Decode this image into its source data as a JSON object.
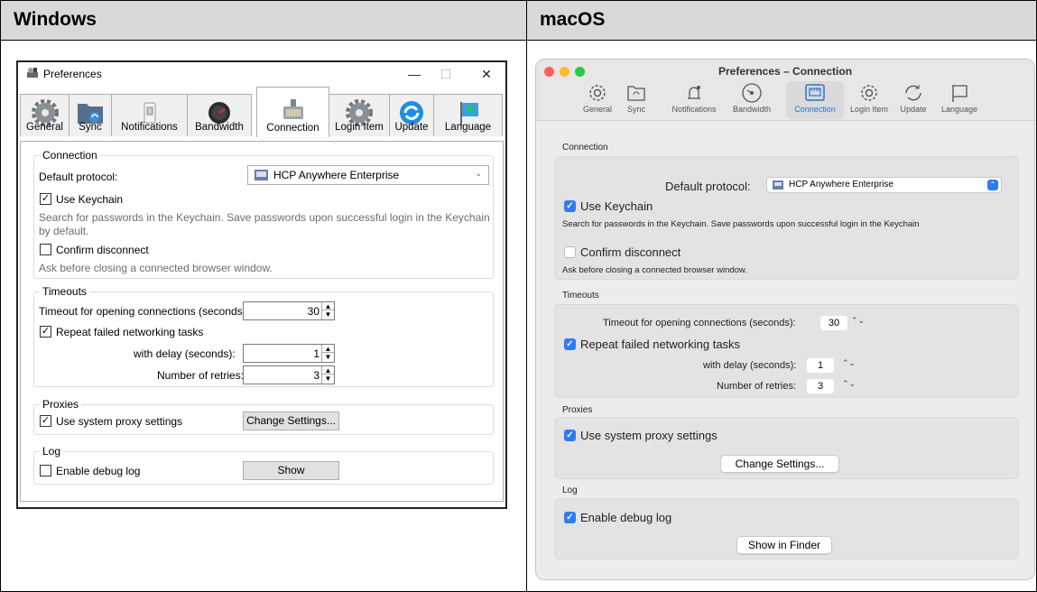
{
  "columns": {
    "windows_header": "Windows",
    "macos_header": "macOS"
  },
  "windows": {
    "title": "Preferences",
    "controls": {
      "minimize": "—",
      "maximize": "☐",
      "close": "✕"
    },
    "tabs": [
      {
        "label": "General",
        "icon": "gear-icon"
      },
      {
        "label": "Sync",
        "icon": "sync-folder-icon"
      },
      {
        "label": "Notifications",
        "icon": "switch-icon"
      },
      {
        "label": "Bandwidth",
        "icon": "gauge-icon"
      },
      {
        "label": "Connection",
        "icon": "network-connector-icon",
        "active": true
      },
      {
        "label": "Login Item",
        "icon": "gear-icon"
      },
      {
        "label": "Update",
        "icon": "update-icon"
      },
      {
        "label": "Language",
        "icon": "flag-icon"
      }
    ],
    "connection": {
      "group_title": "Connection",
      "default_protocol_label": "Default protocol:",
      "default_protocol_value": "HCP Anywhere Enterprise",
      "use_keychain_label": "Use Keychain",
      "use_keychain_checked": true,
      "keychain_help": "Search for passwords in the Keychain. Save passwords upon successful login in the Keychain by default.",
      "confirm_disconnect_label": "Confirm disconnect",
      "confirm_disconnect_checked": false,
      "confirm_help": "Ask before closing a connected browser window."
    },
    "timeouts": {
      "group_title": "Timeouts",
      "timeout_label": "Timeout for opening connections (seconds):",
      "timeout_value": "30",
      "repeat_label": "Repeat failed networking tasks",
      "repeat_checked": true,
      "delay_label": "with delay (seconds):",
      "delay_value": "1",
      "retries_label": "Number of retries:",
      "retries_value": "3"
    },
    "proxies": {
      "group_title": "Proxies",
      "system_proxy_label": "Use system proxy settings",
      "system_proxy_checked": true,
      "change_button": "Change Settings..."
    },
    "log": {
      "group_title": "Log",
      "debug_label": "Enable debug log",
      "debug_checked": false,
      "show_button": "Show"
    }
  },
  "macos": {
    "title": "Preferences – Connection",
    "tabs": [
      {
        "label": "General",
        "icon": "gear-icon"
      },
      {
        "label": "Sync",
        "icon": "sync-folder-icon"
      },
      {
        "label": "Notifications",
        "icon": "bell-icon"
      },
      {
        "label": "Bandwidth",
        "icon": "gauge-icon"
      },
      {
        "label": "Connection",
        "icon": "ethernet-port-icon",
        "active": true
      },
      {
        "label": "Login Item",
        "icon": "gear-icon"
      },
      {
        "label": "Update",
        "icon": "update-icon"
      },
      {
        "label": "Language",
        "icon": "flag-icon"
      }
    ],
    "connection": {
      "section_title": "Connection",
      "default_protocol_label": "Default protocol:",
      "default_protocol_value": "HCP Anywhere Enterprise",
      "use_keychain_label": "Use Keychain",
      "use_keychain_checked": true,
      "keychain_help": "Search for passwords in the Keychain. Save passwords upon successful login in the Keychain",
      "confirm_disconnect_label": "Confirm disconnect",
      "confirm_disconnect_checked": false,
      "confirm_help": "Ask before closing a connected browser window."
    },
    "timeouts": {
      "section_title": "Timeouts",
      "timeout_label": "Timeout for opening connections (seconds):",
      "timeout_value": "30",
      "repeat_label": "Repeat failed networking tasks",
      "repeat_checked": true,
      "delay_label": "with delay (seconds):",
      "delay_value": "1",
      "retries_label": "Number of retries:",
      "retries_value": "3"
    },
    "proxies": {
      "section_title": "Proxies",
      "system_proxy_label": "Use system proxy settings",
      "system_proxy_checked": true,
      "change_button": "Change Settings..."
    },
    "log": {
      "section_title": "Log",
      "debug_label": "Enable debug log",
      "debug_checked": true,
      "show_button": "Show in Finder"
    }
  },
  "colors": {
    "mac_accent": "#2f7bf5",
    "header_bg": "#d9d9d9",
    "traffic_red": "#fe5f57",
    "traffic_yellow": "#febc2e",
    "traffic_green": "#28c840"
  }
}
